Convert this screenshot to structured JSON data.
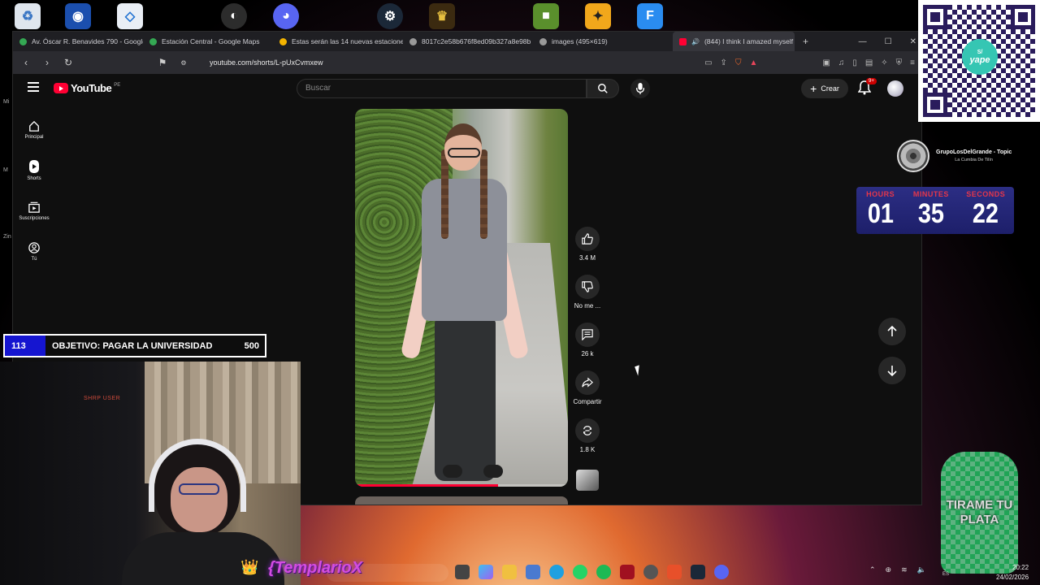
{
  "browser": {
    "tabs": [
      {
        "title": "Av. Óscar R. Benavides 790 - Google",
        "active": false,
        "color": "#34a853"
      },
      {
        "title": "Estación Central - Google Maps",
        "active": false,
        "color": "#34a853"
      },
      {
        "title": "Estas serán las 14 nuevas estacione",
        "active": false,
        "color": "#f4b400"
      },
      {
        "title": "8017c2e58b676f8ed09b327a8e98b",
        "active": false,
        "color": "#999999"
      },
      {
        "title": "images (495×619)",
        "active": false,
        "color": "#999999"
      },
      {
        "title": "(844) I think I amazed myself",
        "active": true,
        "color": "#ff0033"
      }
    ],
    "url": "youtube.com/shorts/L-pUxCvmxew"
  },
  "youtube": {
    "logo_text": "YouTube",
    "region": "PE",
    "search_placeholder": "Buscar",
    "create_label": "Crear",
    "notification_badge": "9+",
    "sidebar": [
      {
        "label": "Principal",
        "icon": "home-icon"
      },
      {
        "label": "Shorts",
        "icon": "shorts-icon"
      },
      {
        "label": "Suscripciones",
        "icon": "subscriptions-icon"
      },
      {
        "label": "Tú",
        "icon": "you-icon"
      }
    ],
    "actions": {
      "likes": "3.4 M",
      "dislike": "No me ...",
      "comments": "26 k",
      "share": "Compartir",
      "remix": "1.8 K"
    },
    "video_progress": 0.67
  },
  "overlay": {
    "yape": {
      "brand": "yape",
      "symbol": "S/"
    },
    "music": {
      "title": "GrupoLosDelGrande - Topic",
      "subtitle": "La Cumbia De Tilín"
    },
    "timer": {
      "hours_label": "HOURS",
      "minutes_label": "MINUTES",
      "seconds_label": "SECONDS",
      "hours": "01",
      "minutes": "35",
      "seconds": "22"
    },
    "goal": {
      "current": "113",
      "text": "OBJETIVO: PAGAR LA UNIVERSIDAD",
      "target": "500"
    },
    "webcam_sign": "SHRP USER",
    "streamer_name": "{TemplarioX",
    "donation_text": "TIRAME TU PLATA"
  },
  "taskbar": {
    "time": "20:22",
    "date": "24/02/2026",
    "lang": "ES"
  }
}
